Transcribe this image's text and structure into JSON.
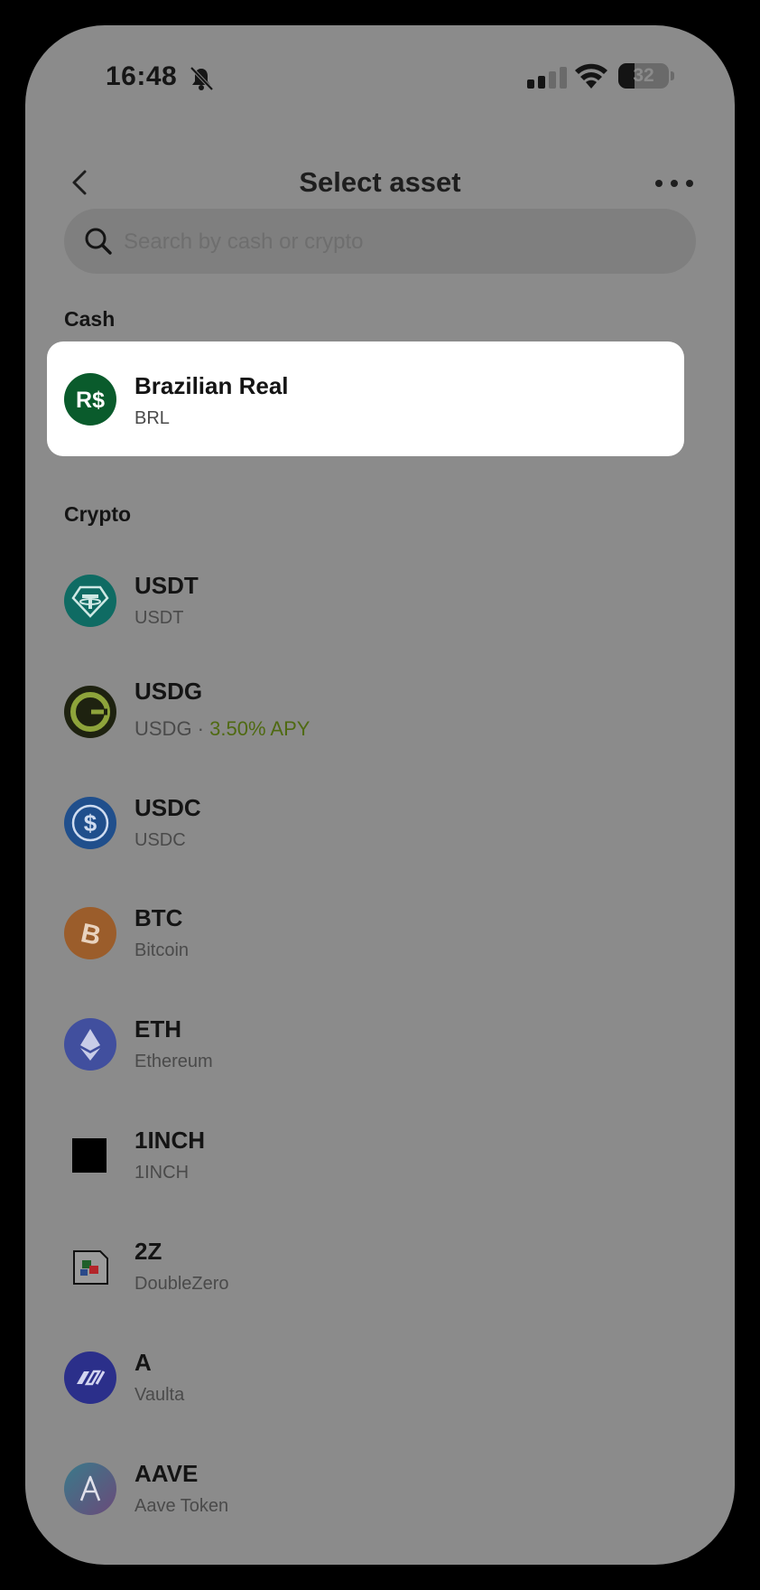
{
  "status_bar": {
    "time": "16:48",
    "battery": "32",
    "battery_fraction": 0.32,
    "icons": [
      "bell-slash-icon",
      "cellular-signal-icon",
      "wifi-icon",
      "battery-icon"
    ]
  },
  "header": {
    "title": "Select asset",
    "back_icon": "chevron-left-icon",
    "more_icon": "ellipsis-icon"
  },
  "search": {
    "placeholder": "Search by cash or crypto",
    "value": "",
    "icon": "search-icon"
  },
  "cash": {
    "label": "Cash",
    "items": [
      {
        "name": "Brazilian Real",
        "code": "BRL",
        "icon": "brl-icon",
        "color": "#0a5b2c"
      }
    ]
  },
  "crypto": {
    "label": "Crypto",
    "items": [
      {
        "name": "USDT",
        "sub": "USDT",
        "icon": "usdt-icon",
        "color": "#0f6b63"
      },
      {
        "name": "USDG",
        "sub": "USDG",
        "sub_sep": " · ",
        "apy": "3.50% APY",
        "icon": "usdg-icon",
        "color": "#1e2210"
      },
      {
        "name": "USDC",
        "sub": "USDC",
        "icon": "usdc-icon",
        "color": "#204f8c"
      },
      {
        "name": "BTC",
        "sub": "Bitcoin",
        "icon": "btc-icon",
        "color": "#9b5d2b"
      },
      {
        "name": "ETH",
        "sub": "Ethereum",
        "icon": "eth-icon",
        "color": "#414f9e"
      },
      {
        "name": "1INCH",
        "sub": "1INCH",
        "icon": "1inch-icon",
        "color": "#000000"
      },
      {
        "name": "2Z",
        "sub": "DoubleZero",
        "icon": "2z-icon",
        "color": "#444444"
      },
      {
        "name": "A",
        "sub": "Vaulta",
        "icon": "vaulta-icon",
        "color": "#2b2f8a"
      },
      {
        "name": "AAVE",
        "sub": "Aave Token",
        "icon": "aave-icon",
        "color": "#4a5a7a"
      }
    ]
  }
}
